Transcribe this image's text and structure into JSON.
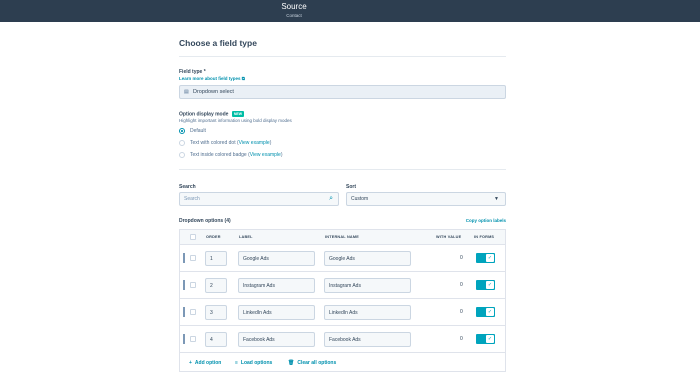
{
  "header": {
    "title": "Source",
    "subtitle": "Contact"
  },
  "main": {
    "heading": "Choose a field type",
    "field_type": {
      "label": "Field type *",
      "learn_more": "Learn more about field types",
      "value": "Dropdown select"
    },
    "display_mode": {
      "label": "Option display mode",
      "badge": "NEW",
      "description": "Highlight important information using bold display modes",
      "options": [
        {
          "text": "Default",
          "selected": true,
          "link": ""
        },
        {
          "text": "Text with colored dot",
          "selected": false,
          "link": "View example"
        },
        {
          "text": "Text inside colored badge",
          "selected": false,
          "link": "View example"
        }
      ]
    },
    "search": {
      "label": "Search",
      "placeholder": "Search"
    },
    "sort": {
      "label": "Sort",
      "value": "Custom"
    },
    "options_header": "Dropdown options (4)",
    "copy_labels": "Copy option labels",
    "table": {
      "columns": [
        "ORDER",
        "LABEL",
        "INTERNAL NAME",
        "WITH VALUE",
        "IN FORMS"
      ],
      "rows": [
        {
          "order": "1",
          "label": "Google Ads",
          "internal": "Google Ads",
          "with_value": "0",
          "in_forms": true
        },
        {
          "order": "2",
          "label": "Instagram Ads",
          "internal": "Instagram Ads",
          "with_value": "0",
          "in_forms": true
        },
        {
          "order": "3",
          "label": "LinkedIn Ads",
          "internal": "LinkedIn Ads",
          "with_value": "0",
          "in_forms": true
        },
        {
          "order": "4",
          "label": "Facebook Ads",
          "internal": "Facebook Ads",
          "with_value": "0",
          "in_forms": true
        }
      ]
    },
    "footer": {
      "add": "Add option",
      "load": "Load options",
      "clear": "Clear all options"
    }
  },
  "colors": {
    "topbar": "#2d3e50",
    "accent": "#00a4bd",
    "link": "#0091ae"
  }
}
